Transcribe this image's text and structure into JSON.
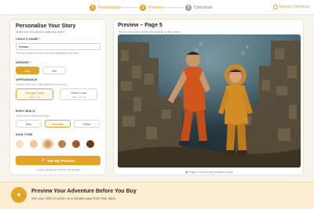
{
  "stepper": {
    "steps": [
      {
        "num": "1",
        "label": "Personalise"
      },
      {
        "num": "2",
        "label": "Preview"
      },
      {
        "num": "3",
        "label": "Checkout"
      }
    ],
    "secure": "Secure Checkout"
  },
  "form": {
    "title": "Personalise Your Story",
    "subtitle": "Make this storybook uniquely theirs",
    "name_label": "CHILD'S NAME *",
    "name_value": "Rowan",
    "name_hint": "This will appear on the cover and throughout the story",
    "gender_label": "GENDER *",
    "gender_options": [
      "Boy",
      "Girl"
    ],
    "appearance_label": "APPEARANCE",
    "appearance_hint": "Choose how your child appears in the story",
    "appearance_options": [
      {
        "title": "Younger Look",
        "sub": "Ages ~7-9"
      },
      {
        "title": "Older Look",
        "sub": "Ages ~10-12"
      }
    ],
    "build_label": "BODY BUILD",
    "build_hint": "Select your child's body type",
    "build_options": [
      "Slim",
      "Average",
      "Fuller"
    ],
    "skin_label": "SKIN TONE",
    "skin_tones": [
      "#f6dcc0",
      "#f0c79a",
      "#d9a066",
      "#c27c45",
      "#9c5a2c",
      "#6b3a1a"
    ],
    "cta": "See My Preview",
    "privacy": "Your details are secure and private"
  },
  "preview": {
    "title": "Preview – Page 5",
    "subtitle": "This is how your child will appear in the story",
    "caption": "Page 5 of your personalised story"
  },
  "banner": {
    "title": "Preview Your Adventure Before You Buy",
    "subtitle": "See your child in action on a sample page from their story."
  },
  "colors": {
    "accent": "#e0a526"
  }
}
